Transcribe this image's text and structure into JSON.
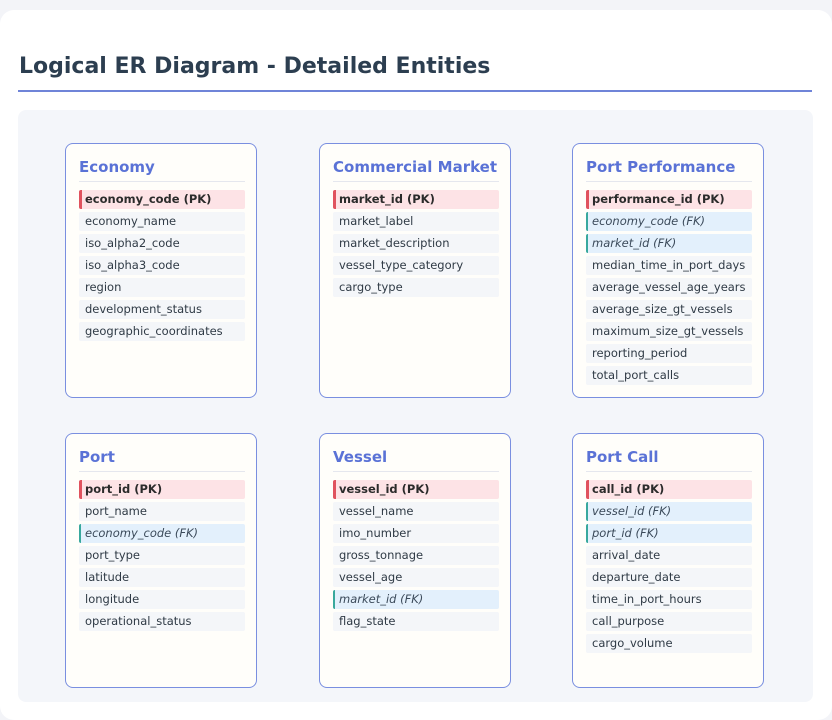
{
  "title": "Logical ER Diagram - Detailed Entities",
  "entities": [
    {
      "name": "Economy",
      "attributes": [
        {
          "label": "economy_code (PK)",
          "kind": "pk"
        },
        {
          "label": "economy_name",
          "kind": "attr"
        },
        {
          "label": "iso_alpha2_code",
          "kind": "attr"
        },
        {
          "label": "iso_alpha3_code",
          "kind": "attr"
        },
        {
          "label": "region",
          "kind": "attr"
        },
        {
          "label": "development_status",
          "kind": "attr"
        },
        {
          "label": "geographic_coordinates",
          "kind": "attr"
        }
      ]
    },
    {
      "name": "Commercial Market",
      "attributes": [
        {
          "label": "market_id (PK)",
          "kind": "pk"
        },
        {
          "label": "market_label",
          "kind": "attr"
        },
        {
          "label": "market_description",
          "kind": "attr"
        },
        {
          "label": "vessel_type_category",
          "kind": "attr"
        },
        {
          "label": "cargo_type",
          "kind": "attr"
        }
      ]
    },
    {
      "name": "Port Performance",
      "attributes": [
        {
          "label": "performance_id (PK)",
          "kind": "pk"
        },
        {
          "label": "economy_code (FK)",
          "kind": "fk"
        },
        {
          "label": "market_id (FK)",
          "kind": "fk"
        },
        {
          "label": "median_time_in_port_days",
          "kind": "attr"
        },
        {
          "label": "average_vessel_age_years",
          "kind": "attr"
        },
        {
          "label": "average_size_gt_vessels",
          "kind": "attr"
        },
        {
          "label": "maximum_size_gt_vessels",
          "kind": "attr"
        },
        {
          "label": "reporting_period",
          "kind": "attr"
        },
        {
          "label": "total_port_calls",
          "kind": "attr"
        }
      ]
    },
    {
      "name": "Port",
      "attributes": [
        {
          "label": "port_id (PK)",
          "kind": "pk"
        },
        {
          "label": "port_name",
          "kind": "attr"
        },
        {
          "label": "economy_code (FK)",
          "kind": "fk"
        },
        {
          "label": "port_type",
          "kind": "attr"
        },
        {
          "label": "latitude",
          "kind": "attr"
        },
        {
          "label": "longitude",
          "kind": "attr"
        },
        {
          "label": "operational_status",
          "kind": "attr"
        }
      ]
    },
    {
      "name": "Vessel",
      "attributes": [
        {
          "label": "vessel_id (PK)",
          "kind": "pk"
        },
        {
          "label": "vessel_name",
          "kind": "attr"
        },
        {
          "label": "imo_number",
          "kind": "attr"
        },
        {
          "label": "gross_tonnage",
          "kind": "attr"
        },
        {
          "label": "vessel_age",
          "kind": "attr"
        },
        {
          "label": "market_id (FK)",
          "kind": "fk"
        },
        {
          "label": "flag_state",
          "kind": "attr"
        }
      ]
    },
    {
      "name": "Port Call",
      "attributes": [
        {
          "label": "call_id (PK)",
          "kind": "pk"
        },
        {
          "label": "vessel_id (FK)",
          "kind": "fk"
        },
        {
          "label": "port_id (FK)",
          "kind": "fk"
        },
        {
          "label": "arrival_date",
          "kind": "attr"
        },
        {
          "label": "departure_date",
          "kind": "attr"
        },
        {
          "label": "time_in_port_hours",
          "kind": "attr"
        },
        {
          "label": "call_purpose",
          "kind": "attr"
        },
        {
          "label": "cargo_volume",
          "kind": "attr"
        }
      ]
    }
  ]
}
